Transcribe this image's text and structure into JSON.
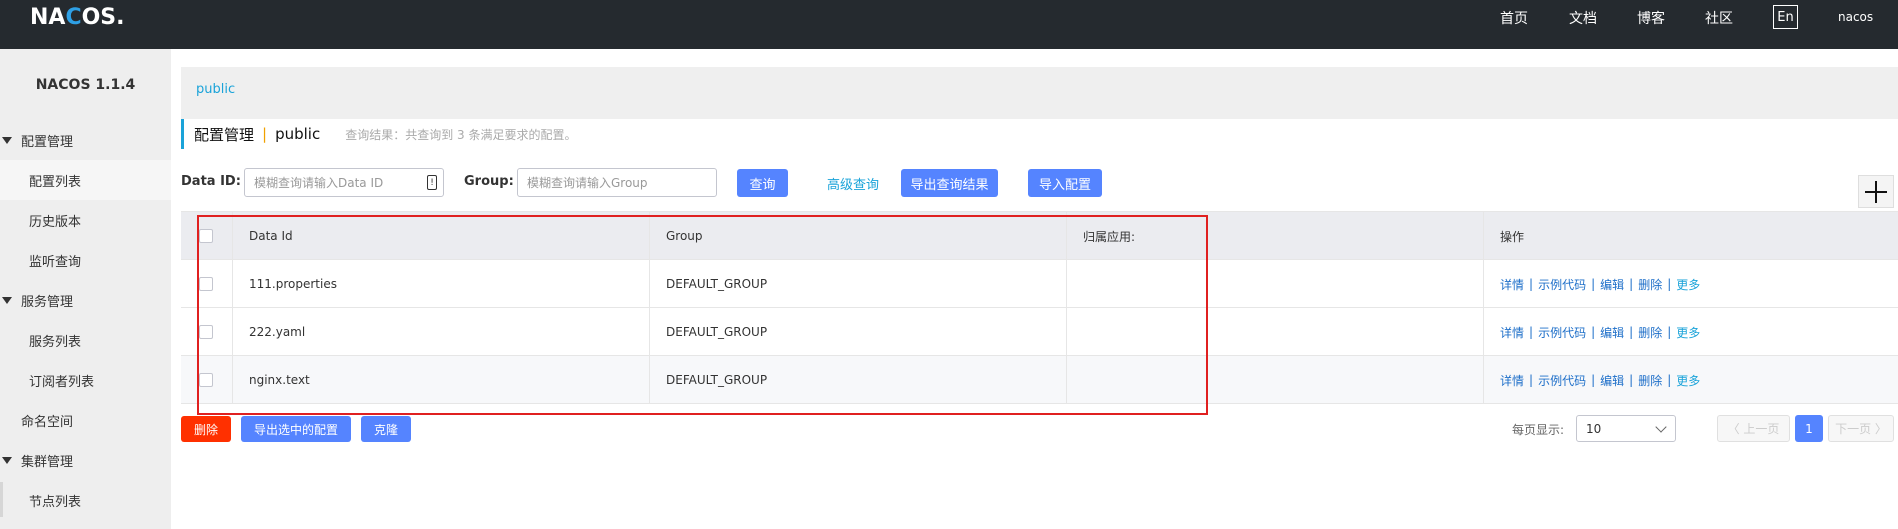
{
  "header": {
    "logo_parts": [
      "NA",
      "C",
      "OS."
    ],
    "nav": [
      "首页",
      "文档",
      "博客",
      "社区"
    ],
    "lang": "En",
    "user": "nacos"
  },
  "sidebar": {
    "title": "NACOS 1.1.4",
    "groups": [
      {
        "label": "配置管理",
        "items": [
          "配置列表",
          "历史版本",
          "监听查询"
        ]
      },
      {
        "label": "服务管理",
        "items": [
          "服务列表",
          "订阅者列表"
        ]
      },
      {
        "label": "命名空间",
        "items": []
      },
      {
        "label": "集群管理",
        "items": [
          "节点列表"
        ]
      }
    ]
  },
  "namespace_bar": {
    "current": "public"
  },
  "title": {
    "section": "配置管理",
    "separator": "|",
    "namespace": "public",
    "result_hint": "查询结果：共查询到 3 条满足要求的配置。"
  },
  "search": {
    "data_id_label": "Data ID:",
    "data_id_placeholder": "模糊查询请输入Data ID",
    "group_label": "Group:",
    "group_placeholder": "模糊查询请输入Group",
    "query_button": "查询",
    "advanced_link": "高级查询",
    "export_button": "导出查询结果",
    "import_button": "导入配置"
  },
  "table": {
    "columns": [
      "Data Id",
      "Group",
      "归属应用:",
      "操作"
    ],
    "rows": [
      {
        "data_id": "111.properties",
        "group": "DEFAULT_GROUP",
        "app": ""
      },
      {
        "data_id": "222.yaml",
        "group": "DEFAULT_GROUP",
        "app": ""
      },
      {
        "data_id": "nginx.text",
        "group": "DEFAULT_GROUP",
        "app": ""
      }
    ],
    "ops": [
      "详情",
      "示例代码",
      "编辑",
      "删除",
      "更多"
    ]
  },
  "bottom": {
    "delete_button": "删除",
    "export_selected_button": "导出选中的配置",
    "clone_button": "克隆",
    "page_size_label": "每页显示:",
    "page_size": "10",
    "prev": "上一页",
    "current_page": "1",
    "next": "下一页"
  },
  "colors": {
    "topbar": "#252a2f",
    "primary": "#5584ff",
    "danger": "#ff3000",
    "link": "#1aa3d9",
    "highlight": "#e02020"
  }
}
